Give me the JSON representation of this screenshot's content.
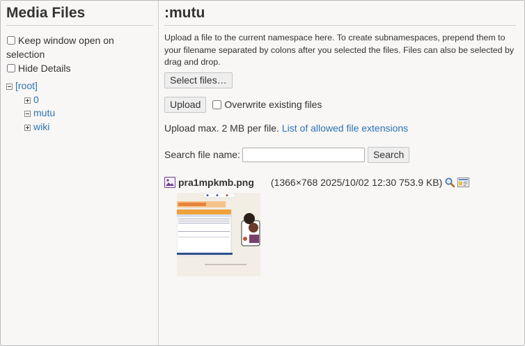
{
  "sidebar": {
    "title": "Media Files",
    "options": [
      {
        "label": "Keep window open on selection",
        "checked": false
      },
      {
        "label": "Hide Details",
        "checked": false
      }
    ],
    "tree": {
      "root": "[root]",
      "children": [
        "0",
        "mutu",
        "wiki"
      ]
    }
  },
  "main": {
    "title": ":mutu",
    "intro": "Upload a file to the current namespace here. To create subnamespaces, prepend them to your filename separated by colons after you selected the files. Files can also be selected by drag and drop.",
    "select_files_label": "Select files…",
    "upload_label": "Upload",
    "overwrite_label": "Overwrite existing files",
    "max_text": "Upload max. 2 MB per file.",
    "extensions_link": "List of allowed file extensions",
    "search_label": "Search file name:",
    "search_value": "",
    "search_button": "Search",
    "file": {
      "name": "pra1mpkmb.png",
      "meta": "(1366×768 2025/10/02 12:30 753.9 KB)"
    }
  },
  "colors": {
    "link": "#2b73b7",
    "background": "#f8f7f5"
  }
}
